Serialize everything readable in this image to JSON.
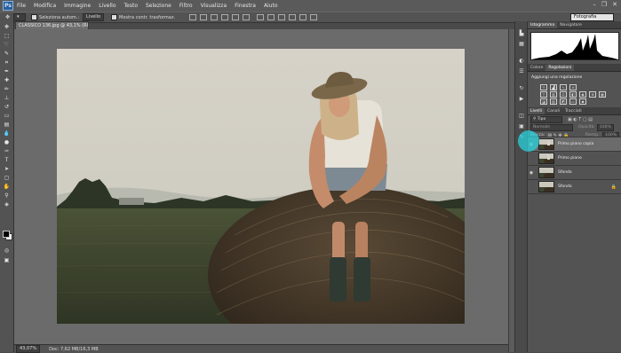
{
  "app": {
    "logo": "Ps"
  },
  "menu": [
    "File",
    "Modifica",
    "Immagine",
    "Livello",
    "Testo",
    "Selezione",
    "Filtro",
    "Visualizza",
    "Finestra",
    "Aiuto"
  ],
  "options_bar": {
    "auto_select_label": "Seleziona autom.:",
    "auto_select_value": "Livello",
    "transform_controls_label": "Mostra contr. trasformaz."
  },
  "workspace": "Fotografia",
  "document_tab": "CLASSICO 136.jpg @ 43,1% (RGB/8*) ×",
  "status": {
    "zoom": "43,07%",
    "doc": "Doc: 7,62 MB/16,3 MB"
  },
  "panels": {
    "histogram_tabs": [
      "Istogramma",
      "Navigatore"
    ],
    "adjust_tabs": [
      "Colore",
      "Regolazioni"
    ],
    "adjust_title": "Aggiungi una regolazione",
    "layers_tabs": [
      "Livelli",
      "Canali",
      "Tracciati"
    ],
    "filter_kind": "Tipo",
    "blend_mode": "Normale",
    "opacity_label": "Opacità:",
    "opacity_value": "100%",
    "lock_label": "Blocca:",
    "fill_label": "Riemp.:",
    "fill_value": "100%"
  },
  "layers": [
    {
      "name": "Primo piano copia",
      "visible": true,
      "selected": true
    },
    {
      "name": "Primo piano",
      "visible": false,
      "selected": false
    },
    {
      "name": "Sfondo",
      "visible": true,
      "selected": false
    },
    {
      "name": "Sfondo",
      "visible": false,
      "selected": false,
      "locked": true
    }
  ]
}
